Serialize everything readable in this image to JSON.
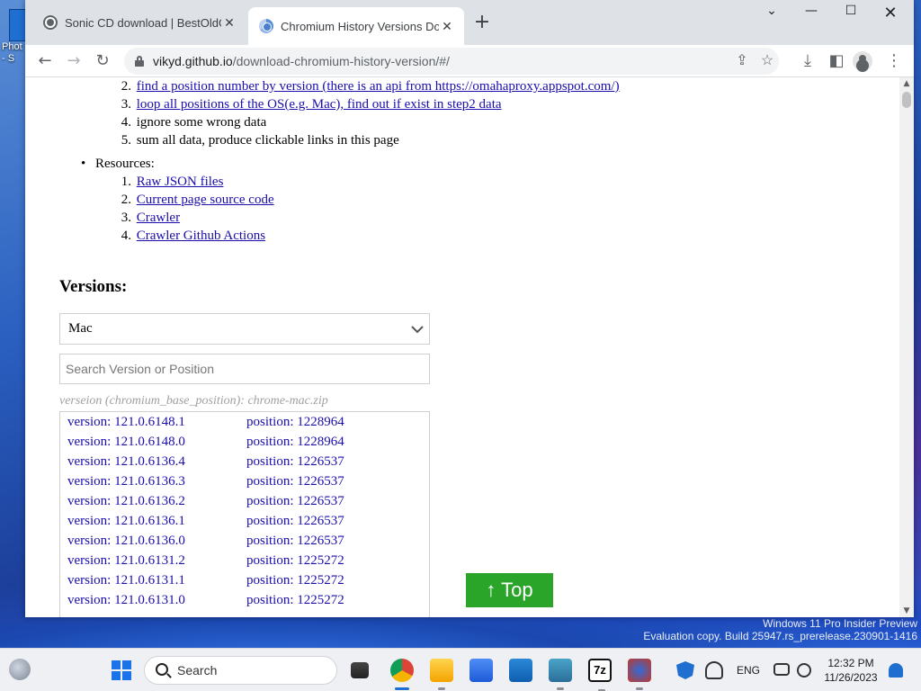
{
  "desktop": {
    "icon_label": "Phot - S",
    "watermark_line1": "Windows 11 Pro Insider Preview",
    "watermark_line2": "Evaluation copy. Build 25947.rs_prerelease.230901-1416"
  },
  "browser": {
    "tabs": [
      {
        "title": "Sonic CD download | BestOldGam",
        "active": false
      },
      {
        "title": "Chromium History Versions Dow",
        "active": true
      }
    ],
    "url_host": "vikyd.github.io",
    "url_path": "/download-chromium-history-version/#/"
  },
  "page": {
    "steps_list": [
      {
        "num": "2.",
        "text": "find a position number by version (there is an api from https://omahaproxy.appspot.com/)",
        "link": true
      },
      {
        "num": "3.",
        "text": "loop all positions of the OS(e.g. Mac), find out if exist in step2 data",
        "link": true
      },
      {
        "num": "4.",
        "text": "ignore some wrong data",
        "link": false
      },
      {
        "num": "5.",
        "text": "sum all data, produce clickable links in this page",
        "link": false
      }
    ],
    "resources_label": "Resources:",
    "resources": [
      {
        "num": "1.",
        "text": "Raw JSON files"
      },
      {
        "num": "2.",
        "text": "Current page source code"
      },
      {
        "num": "3.",
        "text": "Crawler"
      },
      {
        "num": "4.",
        "text": "Crawler Github Actions"
      }
    ],
    "versions_heading": "Versions:",
    "os_select_value": "Mac",
    "search_placeholder": "Search Version or Position",
    "hint": "verseion (chromium_base_position): chrome-mac.zip",
    "results": [
      {
        "version": "version: 121.0.6148.1",
        "position": "position: 1228964"
      },
      {
        "version": "version: 121.0.6148.0",
        "position": "position: 1228964"
      },
      {
        "version": "version: 121.0.6136.4",
        "position": "position: 1226537"
      },
      {
        "version": "version: 121.0.6136.3",
        "position": "position: 1226537"
      },
      {
        "version": "version: 121.0.6136.2",
        "position": "position: 1226537"
      },
      {
        "version": "version: 121.0.6136.1",
        "position": "position: 1226537"
      },
      {
        "version": "version: 121.0.6136.0",
        "position": "position: 1226537"
      },
      {
        "version": "version: 121.0.6131.2",
        "position": "position: 1225272"
      },
      {
        "version": "version: 121.0.6131.1",
        "position": "position: 1225272"
      },
      {
        "version": "version: 121.0.6131.0",
        "position": "position: 1225272"
      }
    ],
    "top_button": "↑ Top"
  },
  "taskbar": {
    "search_label": "Search",
    "lang": "ENG",
    "time": "12:32 PM",
    "date": "11/26/2023"
  },
  "colors": {
    "link": "#1a0dab",
    "top_button": "#2aa52a",
    "tabbar": "#dee1e6"
  }
}
